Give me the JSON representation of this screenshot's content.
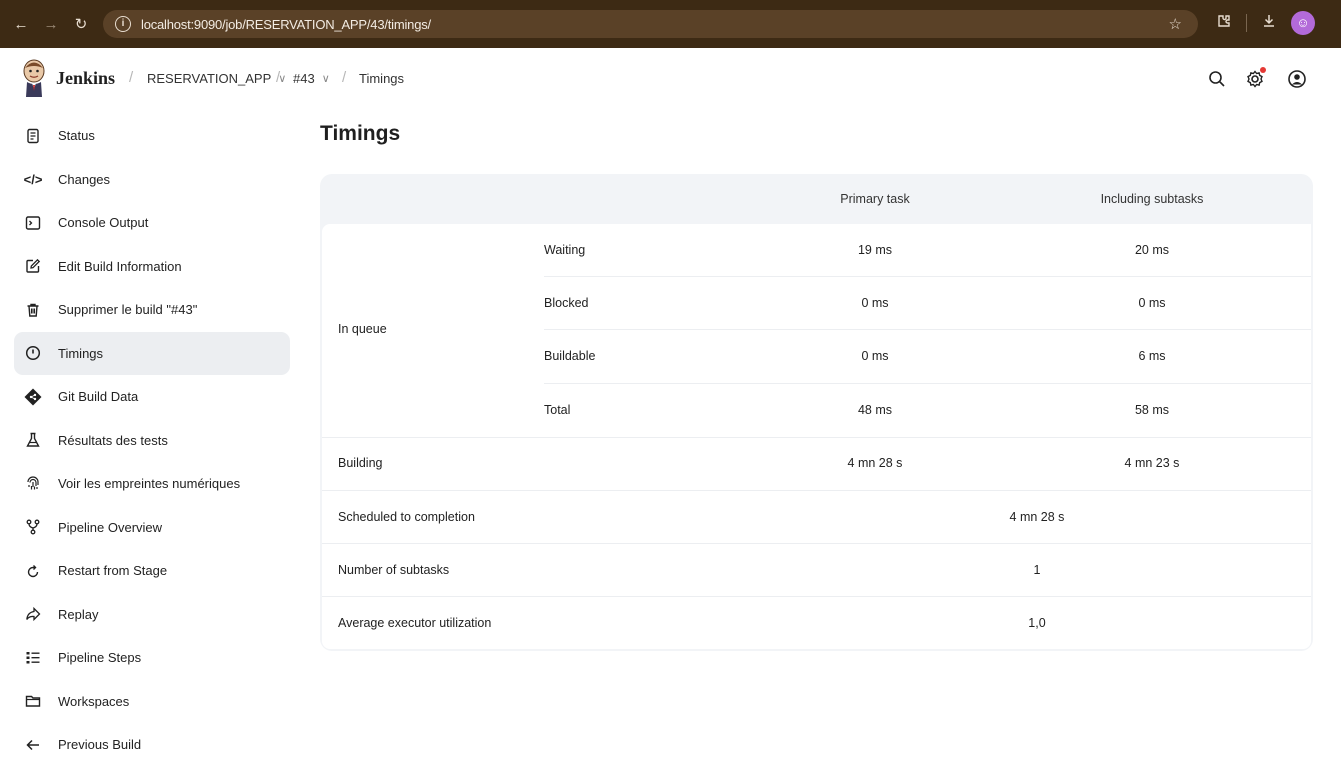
{
  "browser": {
    "url": "localhost:9090/job/RESERVATION_APP/43/timings/"
  },
  "header": {
    "brand": "Jenkins",
    "breadcrumbs": [
      "RESERVATION_APP",
      "#43",
      "Timings"
    ]
  },
  "sidebar": {
    "items": [
      {
        "label": "Status",
        "icon": "document-icon"
      },
      {
        "label": "Changes",
        "icon": "code-icon"
      },
      {
        "label": "Console Output",
        "icon": "terminal-icon"
      },
      {
        "label": "Edit Build Information",
        "icon": "edit-icon"
      },
      {
        "label": "Supprimer le build \"#43\"",
        "icon": "trash-icon"
      },
      {
        "label": "Timings",
        "icon": "clock-icon"
      },
      {
        "label": "Git Build Data",
        "icon": "git-icon"
      },
      {
        "label": "Résultats des tests",
        "icon": "flask-icon"
      },
      {
        "label": "Voir les empreintes numériques",
        "icon": "fingerprint-icon"
      },
      {
        "label": "Pipeline Overview",
        "icon": "pipeline-icon"
      },
      {
        "label": "Restart from Stage",
        "icon": "restart-icon"
      },
      {
        "label": "Replay",
        "icon": "replay-icon"
      },
      {
        "label": "Pipeline Steps",
        "icon": "steps-icon"
      },
      {
        "label": "Workspaces",
        "icon": "folder-icon"
      },
      {
        "label": "Previous Build",
        "icon": "arrow-left-icon"
      }
    ],
    "active": "Timings"
  },
  "main": {
    "title": "Timings",
    "columns": [
      "Primary task",
      "Including subtasks"
    ],
    "queue_label": "In queue",
    "queue_rows": [
      {
        "label": "Waiting",
        "primary": "19 ms",
        "subtasks": "20 ms"
      },
      {
        "label": "Blocked",
        "primary": "0 ms",
        "subtasks": "0 ms"
      },
      {
        "label": "Buildable",
        "primary": "0 ms",
        "subtasks": "6 ms"
      },
      {
        "label": "Total",
        "primary": "48 ms",
        "subtasks": "58 ms"
      }
    ],
    "building": {
      "label": "Building",
      "primary": "4 mn 28 s",
      "subtasks": "4 mn 23 s"
    },
    "summary_rows": [
      {
        "label": "Scheduled to completion",
        "value": "4 mn 28 s"
      },
      {
        "label": "Number of subtasks",
        "value": "1"
      },
      {
        "label": "Average executor utilization",
        "value": "1,0"
      }
    ]
  }
}
